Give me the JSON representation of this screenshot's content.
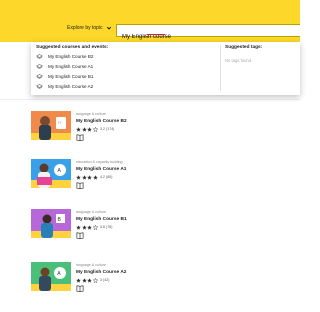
{
  "header": {
    "explore_label": "Explore by topic",
    "search_value": "My English course",
    "bg_color": "#fdd82a"
  },
  "dropdown": {
    "courses_title": "Suggested courses and events:",
    "tags_title": "Suggested tags:",
    "no_tags": "No tags found",
    "items": [
      {
        "label": "My English Course B2"
      },
      {
        "label": "My English Course A1"
      },
      {
        "label": "My English Course B1"
      },
      {
        "label": "My English Course A2"
      }
    ]
  },
  "results": [
    {
      "category": "language & culture",
      "title": "My English Course B2",
      "rating": 3,
      "rating_text": "3.2 (174)",
      "thumb_color": "#f08a4b",
      "accent": "#ffd23f"
    },
    {
      "category": "education & capacity building",
      "title": "My English Course A1",
      "rating": 4,
      "rating_text": "4.2 (65)",
      "thumb_color": "#3aa0e8",
      "accent": "#ffd23f"
    },
    {
      "category": "language & culture",
      "title": "My English Course B1",
      "rating": 3,
      "rating_text": "3.6 (76)",
      "thumb_color": "#b667d8",
      "accent": "#ffd23f"
    },
    {
      "category": "language & culture",
      "title": "My English Course A2",
      "rating": 3,
      "rating_text": "3 (42)",
      "thumb_color": "#4bbf7a",
      "accent": "#ffd23f"
    }
  ]
}
